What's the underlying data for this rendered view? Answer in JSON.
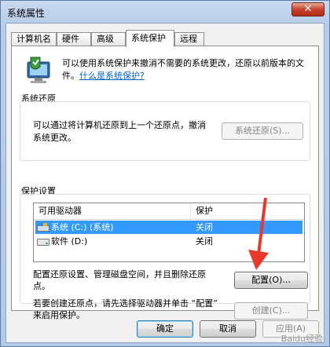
{
  "window": {
    "title": "系统属性",
    "close_glyph": "✕"
  },
  "tabs": [
    {
      "label": "计算机名",
      "active": false
    },
    {
      "label": "硬件",
      "active": false
    },
    {
      "label": "高级",
      "active": false
    },
    {
      "label": "系统保护",
      "active": true
    },
    {
      "label": "远程",
      "active": false
    }
  ],
  "intro": {
    "text": "可以使用系统保护来撤消不需要的系统更改，还原以前版本的文件。",
    "link": "什么是系统保护?",
    "icon": "shield-icon"
  },
  "restore": {
    "group_title": "系统还原",
    "text": "可以通过将计算机还原到上一个还原点，撤消系统更改。",
    "button_label": "系统还原(S)..."
  },
  "protection": {
    "group_title": "保护设置",
    "columns": [
      "可用驱动器",
      "保护"
    ],
    "drives": [
      {
        "name": "系统 (C:) (系统)",
        "protection": "关闭",
        "selected": true
      },
      {
        "name": "软件 (D:)",
        "protection": "关闭",
        "selected": false
      }
    ],
    "configure_text": "配置还原设置、管理磁盘空间，并且删除还原点。",
    "configure_button": "配置(O)...",
    "create_text": "若要创建还原点，请先选择驱动器并单击 “配置” 来启用保护。",
    "create_button": "创建(C)..."
  },
  "footer": {
    "ok": "确定",
    "cancel": "取消",
    "apply": "应用(A)"
  },
  "watermark": "Baidu经验",
  "colors": {
    "accent": "#3399ff",
    "arrow": "#e8382b",
    "link": "#0066cc"
  }
}
